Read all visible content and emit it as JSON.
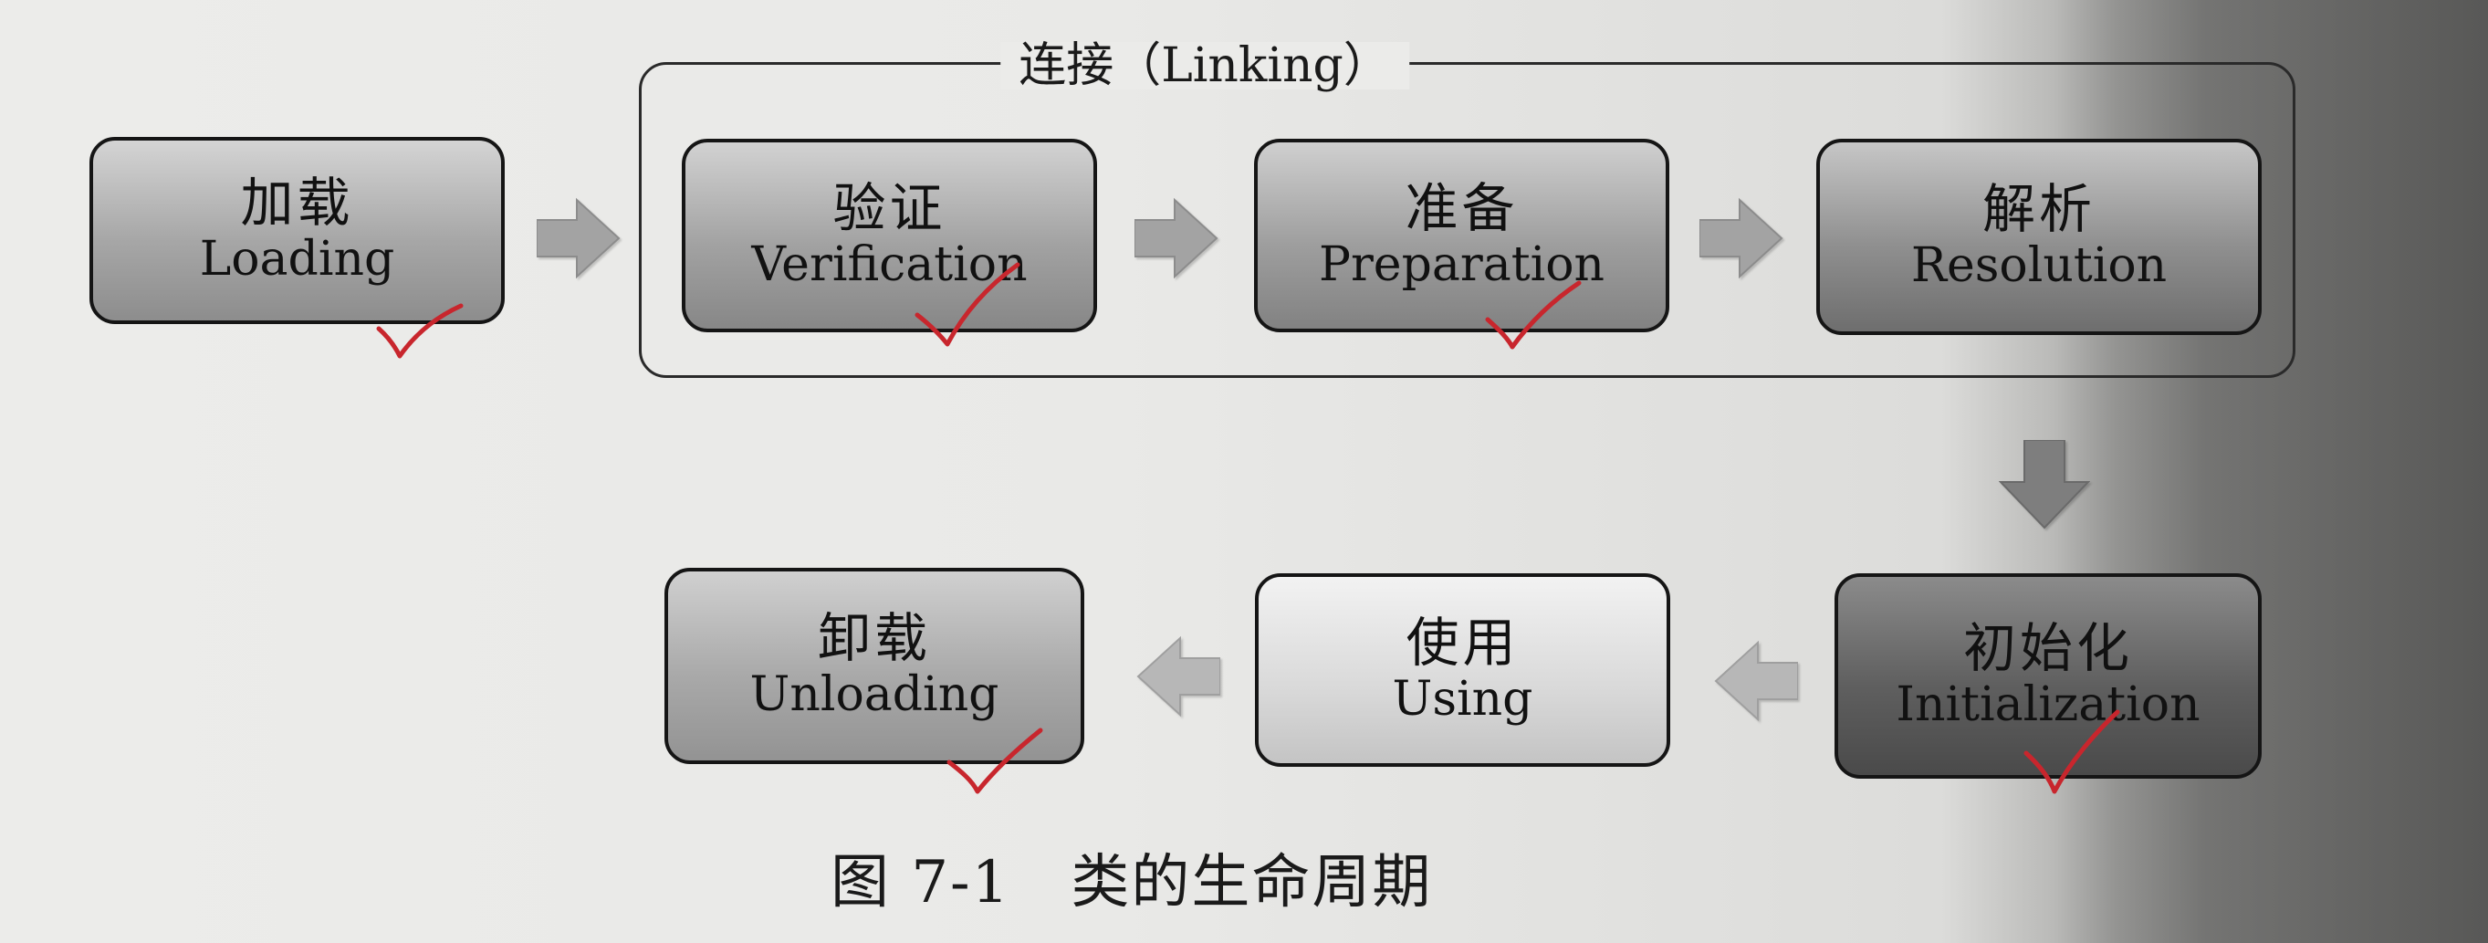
{
  "diagram": {
    "group_label": "连接（Linking）",
    "stages": [
      {
        "id": "loading",
        "zh": "加载",
        "en": "Loading",
        "checked": true
      },
      {
        "id": "verification",
        "zh": "验证",
        "en": "Verification",
        "checked": true
      },
      {
        "id": "preparation",
        "zh": "准备",
        "en": "Preparation",
        "checked": true
      },
      {
        "id": "resolution",
        "zh": "解析",
        "en": "Resolution",
        "checked": false
      },
      {
        "id": "initialization",
        "zh": "初始化",
        "en": "Initialization",
        "checked": true
      },
      {
        "id": "using",
        "zh": "使用",
        "en": "Using",
        "checked": false
      },
      {
        "id": "unloading",
        "zh": "卸载",
        "en": "Unloading",
        "checked": true
      }
    ],
    "caption": "图 7-1　类的生命周期"
  },
  "colors": {
    "check_mark": "#c8262d",
    "arrow_fill": "#a3a3a3",
    "border": "#151515"
  }
}
